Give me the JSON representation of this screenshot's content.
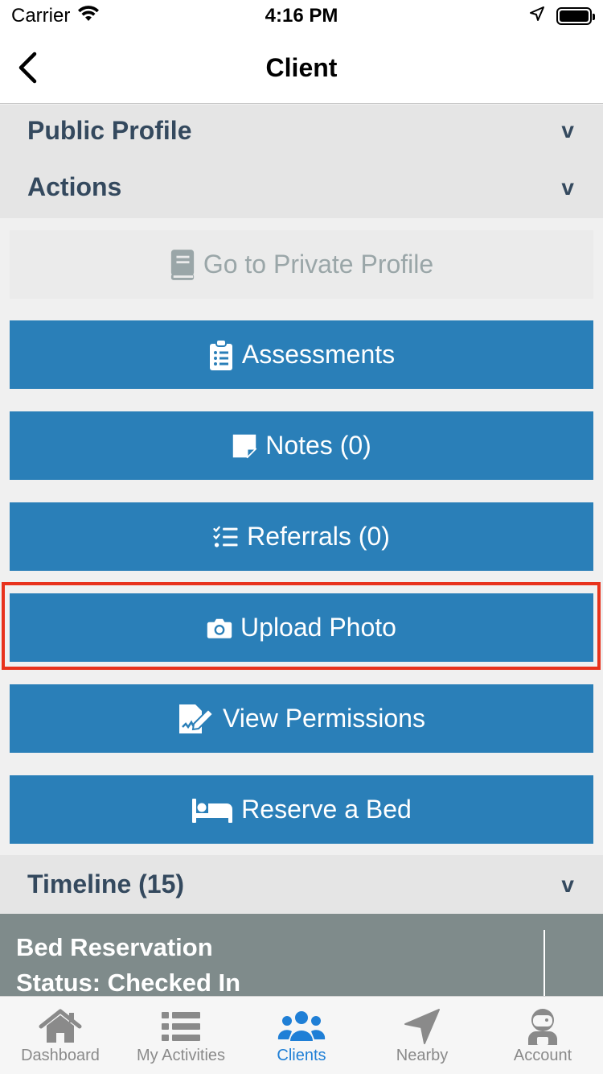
{
  "status_bar": {
    "carrier": "Carrier",
    "time": "4:16 PM"
  },
  "nav": {
    "title": "Client"
  },
  "sections": {
    "public_profile": "Public Profile",
    "actions": "Actions",
    "timeline": "Timeline (15)",
    "chevron": "v"
  },
  "actions": {
    "private_profile": "Go to Private Profile",
    "assessments": "Assessments",
    "notes": "Notes (0)",
    "referrals": "Referrals (0)",
    "upload_photo": "Upload Photo",
    "view_permissions": "View Permissions",
    "reserve_bed": "Reserve a Bed"
  },
  "timeline_item": {
    "line1": "Bed Reservation",
    "line2": "Status: Checked In"
  },
  "tabs": [
    {
      "label": "Dashboard",
      "icon": "home-icon"
    },
    {
      "label": "My Activities",
      "icon": "list-icon"
    },
    {
      "label": "Clients",
      "icon": "users-icon",
      "active": true
    },
    {
      "label": "Nearby",
      "icon": "location-arrow-icon"
    },
    {
      "label": "Account",
      "icon": "astronaut-icon"
    }
  ],
  "colors": {
    "button": "#2a7fb8",
    "active_tab": "#1f7fd6",
    "highlight": "#e8321c",
    "header_text": "#34495e"
  }
}
